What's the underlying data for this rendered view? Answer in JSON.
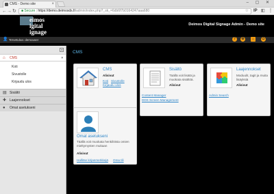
{
  "browser": {
    "tab_title": "CMS - Demo site",
    "url_secure_label": "Secure",
    "url_host": "https://demo.deimosds.fi",
    "url_path": "/admin/index.php?_sk_=6db6f7b0164247aaa680",
    "ext_label": "IP"
  },
  "header": {
    "logo_lines": [
      "eimos",
      "igital",
      "ignage"
    ],
    "app_title": "Deimos Digital Signage Admin - Demo site"
  },
  "userbar": {
    "username": "Tervetuloa: demouser"
  },
  "sidebar": {
    "section_label": "CMS",
    "sub_items": [
      "Koti",
      "Sivustolle",
      "Kirjaudu ulos"
    ],
    "bars": [
      "Sisältö",
      "Laajennokset",
      "Omat asetukseni"
    ]
  },
  "main": {
    "title": "CMS",
    "cards": [
      {
        "title": "CMS",
        "desc": "",
        "alo": "Alisivut",
        "links": [
          "Koti",
          "Sivustolle",
          "Kirjaudu ulos"
        ]
      },
      {
        "title": "Sisältö",
        "desc": "Täällä voit lisätä ja muokata sisältöä.",
        "alo": "Alisivut",
        "links": [
          "Content Manager",
          "DDS Screen Management"
        ]
      },
      {
        "title": "Laajennokset",
        "desc": "Moduulit, tagit ja muita lisäyksiä",
        "alo": "Alisivut",
        "links": [
          "Admin Search"
        ]
      },
      {
        "title": "Omat asetukseni",
        "desc": "Täällä voit muokata henkilöista omien mieltymysten mukaan",
        "alo": "Alisivut",
        "links": [
          "Hallitse kirjanmerkkejä",
          "Oma tili"
        ]
      }
    ]
  },
  "colors": {
    "accent": "#2f86c8",
    "heading_blue": "#5fb6e8",
    "userbar_icon": "#f39c12"
  }
}
